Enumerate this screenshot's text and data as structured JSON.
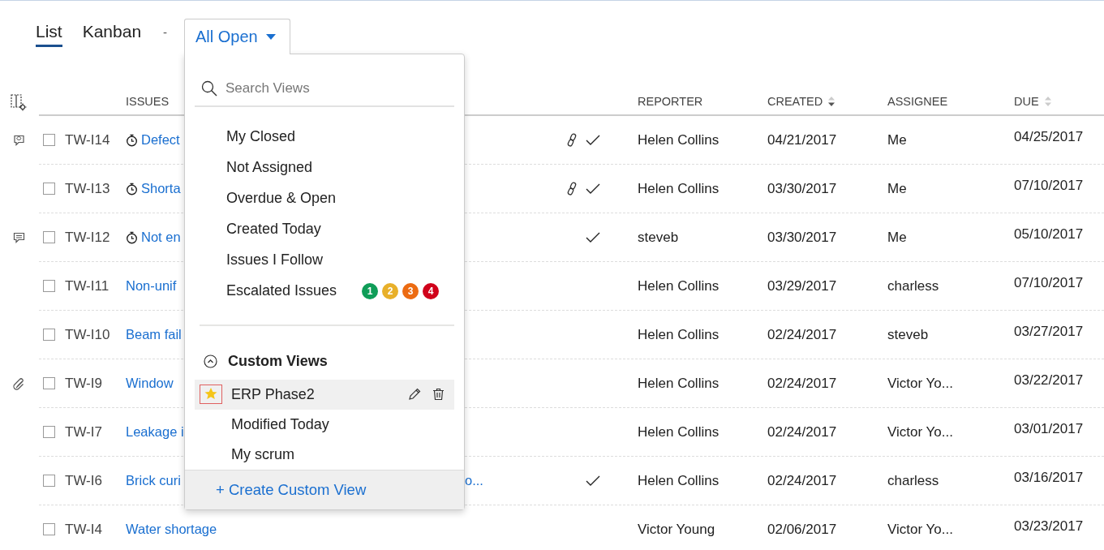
{
  "view_tabs": [
    {
      "label": "List",
      "selected": true
    },
    {
      "label": "Kanban",
      "selected": false
    }
  ],
  "separator": "-",
  "view_picker": {
    "label": "All Open",
    "expanded": true
  },
  "dropdown": {
    "search": {
      "placeholder": "Search Views"
    },
    "views": [
      {
        "label": "My Closed"
      },
      {
        "label": "Not Assigned"
      },
      {
        "label": "Overdue & Open"
      },
      {
        "label": "Created Today"
      },
      {
        "label": "Issues I Follow"
      },
      {
        "label": "Escalated Issues",
        "badges": [
          {
            "text": "1",
            "color": "#0f9d58"
          },
          {
            "text": "2",
            "color": "#e8b02a"
          },
          {
            "text": "3",
            "color": "#ec6b12"
          },
          {
            "text": "4",
            "color": "#d0021b"
          }
        ]
      }
    ],
    "custom_views": {
      "title": "Custom Views",
      "expanded": true,
      "items": [
        {
          "label": "ERP Phase2",
          "selected": true,
          "favorite": true
        },
        {
          "label": "Modified Today",
          "selected": false,
          "favorite": false
        },
        {
          "label": "My scrum",
          "selected": false,
          "favorite": false
        }
      ]
    },
    "create_link": "+ Create Custom View"
  },
  "table": {
    "columns": [
      {
        "label": "ISSUES",
        "sort_icon": false,
        "sorted": false
      },
      {
        "label": "REPORTER",
        "sort_icon": false,
        "sorted": false
      },
      {
        "label": "CREATED",
        "sort_icon": true,
        "sorted": true
      },
      {
        "label": "ASSIGNEE",
        "sort_icon": false,
        "sorted": false
      },
      {
        "label": "DUE",
        "sort_icon": true,
        "sorted": false
      }
    ],
    "rows": [
      {
        "kind": "feedback",
        "checked": false,
        "id": "TW-I14",
        "timer": true,
        "title": "Defect",
        "linked": true,
        "done": true,
        "reporter": "Helen Collins",
        "created": "04/21/2017",
        "assignee": "Me",
        "due": "04/25/2017"
      },
      {
        "kind": "plain",
        "checked": false,
        "id": "TW-I13",
        "timer": true,
        "title": "Shorta",
        "linked": true,
        "done": true,
        "reporter": "Helen Collins",
        "created": "03/30/2017",
        "assignee": "Me",
        "due": "07/10/2017"
      },
      {
        "kind": "comment",
        "checked": false,
        "id": "TW-I12",
        "timer": true,
        "title": "Not en",
        "linked": false,
        "done": true,
        "reporter": "steveb",
        "created": "03/30/2017",
        "assignee": "Me",
        "due": "05/10/2017"
      },
      {
        "kind": "plain",
        "checked": false,
        "id": "TW-I11",
        "timer": false,
        "title": "Non-unif",
        "linked": false,
        "done": false,
        "reporter": "Helen Collins",
        "created": "03/29/2017",
        "assignee": "charless",
        "due": "07/10/2017"
      },
      {
        "kind": "plain",
        "checked": false,
        "id": "TW-I10",
        "timer": false,
        "title": "Beam fail",
        "linked": false,
        "done": false,
        "reporter": "Helen Collins",
        "created": "02/24/2017",
        "assignee": "steveb",
        "due": "03/27/2017"
      },
      {
        "kind": "attachment",
        "checked": false,
        "id": "TW-I9",
        "timer": false,
        "title": "Window",
        "linked": false,
        "done": false,
        "reporter": "Helen Collins",
        "created": "02/24/2017",
        "assignee": "Victor Yo...",
        "due": "03/22/2017"
      },
      {
        "kind": "plain",
        "checked": false,
        "id": "TW-I7",
        "timer": false,
        "title": "Leakage i",
        "linked": false,
        "done": false,
        "reporter": "Helen Collins",
        "created": "02/24/2017",
        "assignee": "Victor Yo...",
        "due": "03/01/2017"
      },
      {
        "kind": "plain",
        "checked": false,
        "id": "TW-I6",
        "timer": false,
        "title": "Brick curi",
        "title_tail": "o...",
        "linked": false,
        "done": true,
        "reporter": "Helen Collins",
        "created": "02/24/2017",
        "assignee": "charless",
        "due": "03/16/2017"
      },
      {
        "kind": "plain",
        "checked": false,
        "id": "TW-I4",
        "timer": false,
        "title": "Water shortage",
        "linked": false,
        "done": false,
        "reporter": "Victor Young",
        "created": "02/06/2017",
        "assignee": "Victor Yo...",
        "due": "03/23/2017"
      }
    ]
  }
}
